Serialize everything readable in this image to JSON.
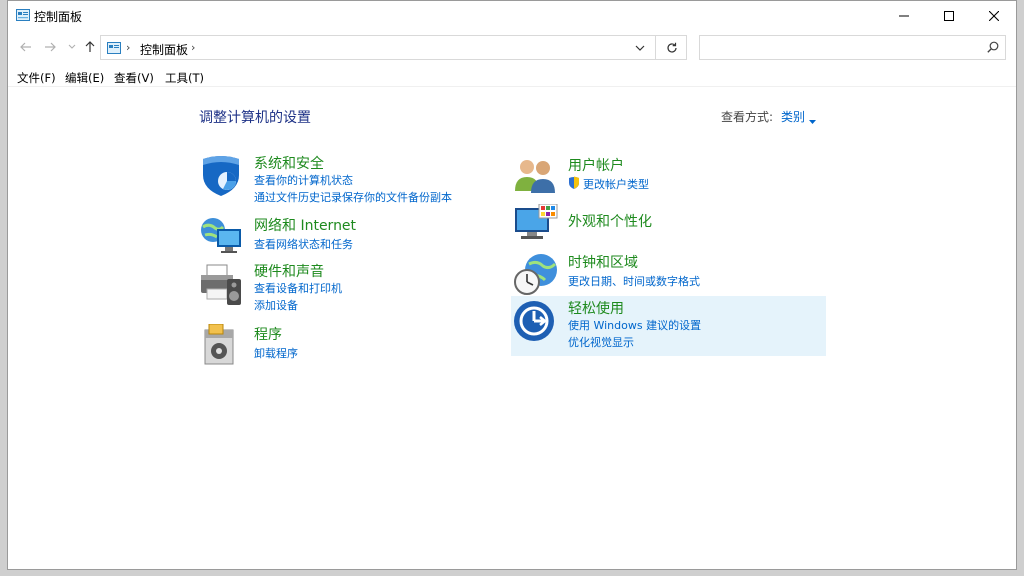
{
  "window": {
    "title": "控制面板",
    "icon": "control-panel-icon"
  },
  "window_controls": {
    "minimize_icon": "minimize-icon",
    "maximize_icon": "maximize-icon",
    "close_icon": "close-icon"
  },
  "address": {
    "crumb": "控制面板",
    "search_placeholder": ""
  },
  "menu": [
    "文件(F)",
    "编辑(E)",
    "查看(V)",
    "工具(T)"
  ],
  "content": {
    "heading": "调整计算机的设置",
    "view_by_label": "查看方式:",
    "view_by_value": "类别"
  },
  "categories": [
    {
      "title": "系统和安全",
      "icon": "shield-icon",
      "links": [
        "查看你的计算机状态",
        "通过文件历史记录保存你的文件备份副本"
      ]
    },
    {
      "title": "网络和 Internet",
      "icon": "network-globe-icon",
      "links": [
        "查看网络状态和任务"
      ]
    },
    {
      "title": "硬件和声音",
      "icon": "printer-speaker-icon",
      "links": [
        "查看设备和打印机",
        "添加设备"
      ]
    },
    {
      "title": "程序",
      "icon": "programs-icon",
      "links": [
        "卸载程序"
      ]
    },
    {
      "title": "用户帐户",
      "icon": "users-icon",
      "links": [
        "更改帐户类型"
      ],
      "link_icon": "uac-shield-icon"
    },
    {
      "title": "外观和个性化",
      "icon": "monitor-palette-icon",
      "links": []
    },
    {
      "title": "时钟和区域",
      "icon": "clock-globe-icon",
      "links": [
        "更改日期、时间或数字格式"
      ]
    },
    {
      "title": "轻松使用",
      "icon": "ease-of-access-icon",
      "links": [
        "使用 Windows 建议的设置",
        "优化视觉显示"
      ]
    }
  ],
  "colors": {
    "heading": "#1e3287",
    "category_title": "#1e8a1e",
    "link": "#0066cc",
    "hover": "#e5f3fb"
  }
}
